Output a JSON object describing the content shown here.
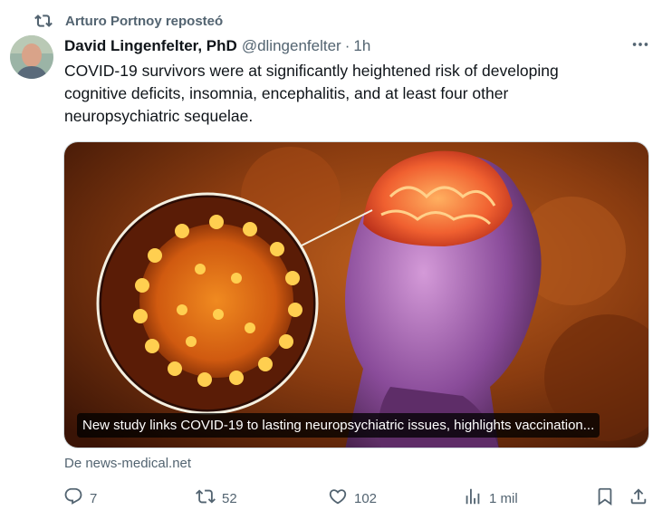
{
  "repost": {
    "icon": "repost-icon",
    "text": "Arturo Portnoy reposteó"
  },
  "author": {
    "name": "David Lingenfelter, PhD",
    "handle": "@dlingenfelter",
    "separator": "·",
    "time": "1h"
  },
  "tweet": {
    "text": "COVID-19 survivors were at significantly heightened risk of developing cognitive deficits, insomnia, encephalitis, and at least four other neuropsychiatric sequelae."
  },
  "card": {
    "caption": "New study links COVID-19 to lasting neuropsychiatric issues, highlights vaccination...",
    "source": "De news-medical.net"
  },
  "actions": {
    "replies": "7",
    "reposts": "52",
    "likes": "102",
    "views": "1 mil"
  },
  "icons": [
    "repost-icon",
    "more-icon",
    "reply-icon",
    "retweet-icon",
    "like-icon",
    "views-icon",
    "bookmark-icon",
    "share-icon"
  ],
  "colors": {
    "secondary_text": "#536471",
    "primary_text": "#0f1419",
    "border": "#cfd9de"
  }
}
